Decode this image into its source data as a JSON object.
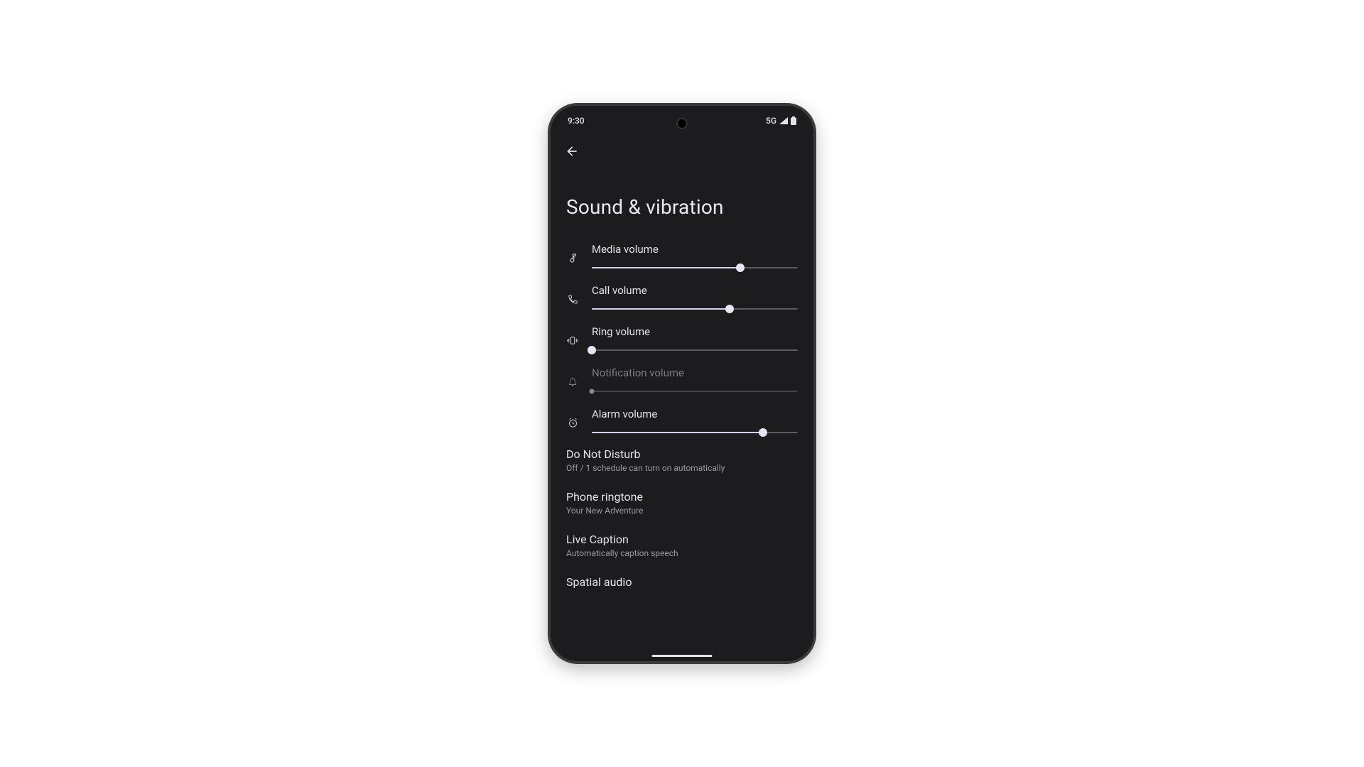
{
  "status": {
    "time": "9:30",
    "network": "5G"
  },
  "page": {
    "title": "Sound & vibration"
  },
  "sliders": [
    {
      "label": "Media volume",
      "percent": 72
    },
    {
      "label": "Call volume",
      "percent": 67
    },
    {
      "label": "Ring volume",
      "percent": 0
    },
    {
      "label": "Notification volume",
      "percent": 0
    },
    {
      "label": "Alarm volume",
      "percent": 83
    }
  ],
  "items": [
    {
      "title": "Do Not Disturb",
      "sub": "Off / 1 schedule can turn on automatically"
    },
    {
      "title": "Phone ringtone",
      "sub": "Your New Adventure"
    },
    {
      "title": "Live Caption",
      "sub": "Automatically caption speech"
    },
    {
      "title": "Spatial audio",
      "sub": ""
    }
  ]
}
